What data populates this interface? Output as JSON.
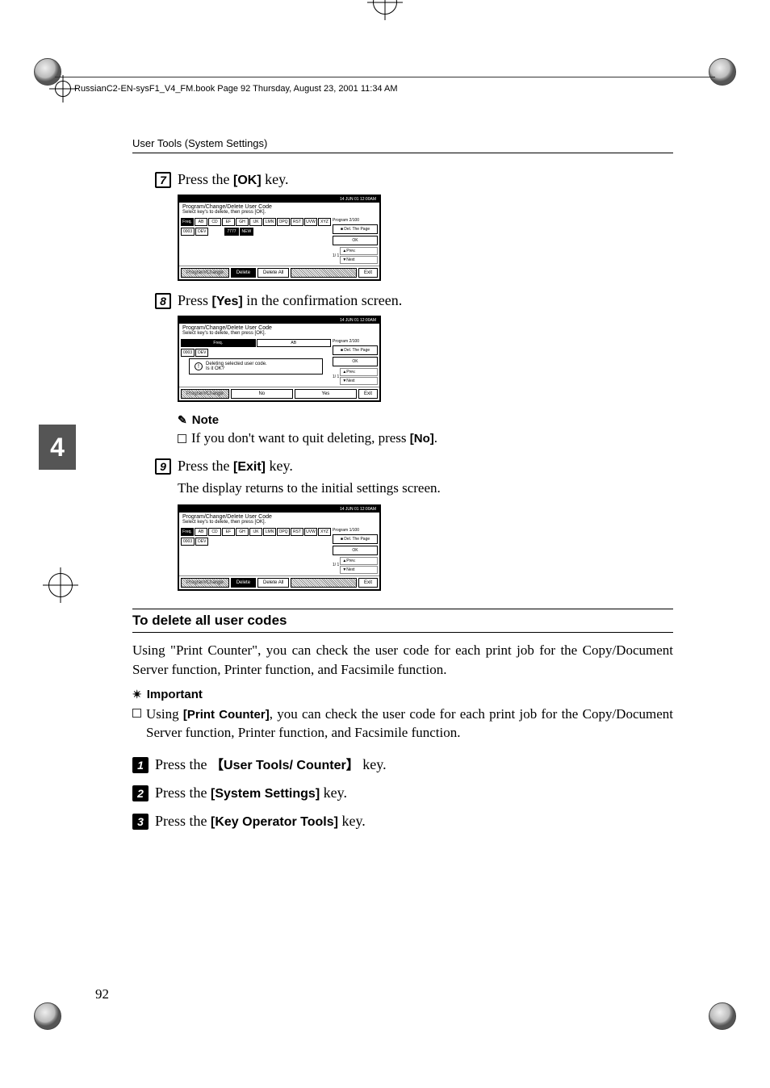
{
  "header": {
    "book_line": "RussianC2-EN-sysF1_V4_FM.book  Page 92  Thursday, August 23, 2001  11:34 AM",
    "running_head": "User Tools (System Settings)"
  },
  "side_tab": "4",
  "page_number": "92",
  "steps": {
    "s7": {
      "num": "7",
      "pre": "Press the ",
      "key": "[OK]",
      "post": " key."
    },
    "s8": {
      "num": "8",
      "pre": "Press ",
      "key": "[Yes]",
      "post": " in the confirmation screen."
    },
    "s9": {
      "num": "9",
      "pre": "Press the ",
      "key": "[Exit]",
      "post": " key."
    },
    "s9_body": "The display returns to the initial settings screen.",
    "a1": {
      "num": "1",
      "pre": "Press the ",
      "key_open": "【",
      "key": "User Tools/ Counter",
      "key_close": "】",
      "post": " key."
    },
    "a2": {
      "num": "2",
      "pre": "Press the ",
      "key": "[System Settings]",
      "post": " key."
    },
    "a3": {
      "num": "3",
      "pre": "Press the ",
      "key": "[Key Operator Tools]",
      "post": " key."
    }
  },
  "note": {
    "heading": "Note",
    "line_pre": "If you don't want to quit deleting, press ",
    "key": "[No]",
    "line_post": "."
  },
  "section": {
    "heading": "To delete all user codes",
    "intro": "Using \"Print Counter\", you can check the user code for each print job for the Copy/Document Server function, Printer function, and Facsimile function.",
    "important_heading": "Important",
    "important_pre": "Using ",
    "important_key": "[Print Counter]",
    "important_post": ", you can check the user code for each print job for the Copy/Document Server function, Printer function, and Facsimile function."
  },
  "shot": {
    "timestamp": "14 JUN 01 12:00AM",
    "title": "Program/Change/Delete User Code",
    "subtitle": "Select key's to delete, then press [OK].",
    "tabs": [
      "Freq.",
      "AB",
      "CD",
      "EF",
      "GH",
      "IJK",
      "LMN",
      "OPQ",
      "RST",
      "UVW",
      "XYZ"
    ],
    "row": {
      "code": "0003",
      "name": "DEV"
    },
    "hi_code": "7777",
    "hi_name": "NEW",
    "program_label": "Program",
    "program_count": "2/100",
    "side": {
      "del_page": "■ Del. The Page",
      "ok": "OK",
      "page": "1/ 1",
      "prev": "▲Prev.",
      "next": "▼Next"
    },
    "bottom": {
      "progchange": "Program/Change",
      "delete": "Delete",
      "delete_all": "Delete All",
      "exit": "Exit"
    },
    "dialog": {
      "text": "Deleting selected user code.",
      "q": "Is it OK?",
      "no": "No",
      "yes": "Yes"
    }
  }
}
